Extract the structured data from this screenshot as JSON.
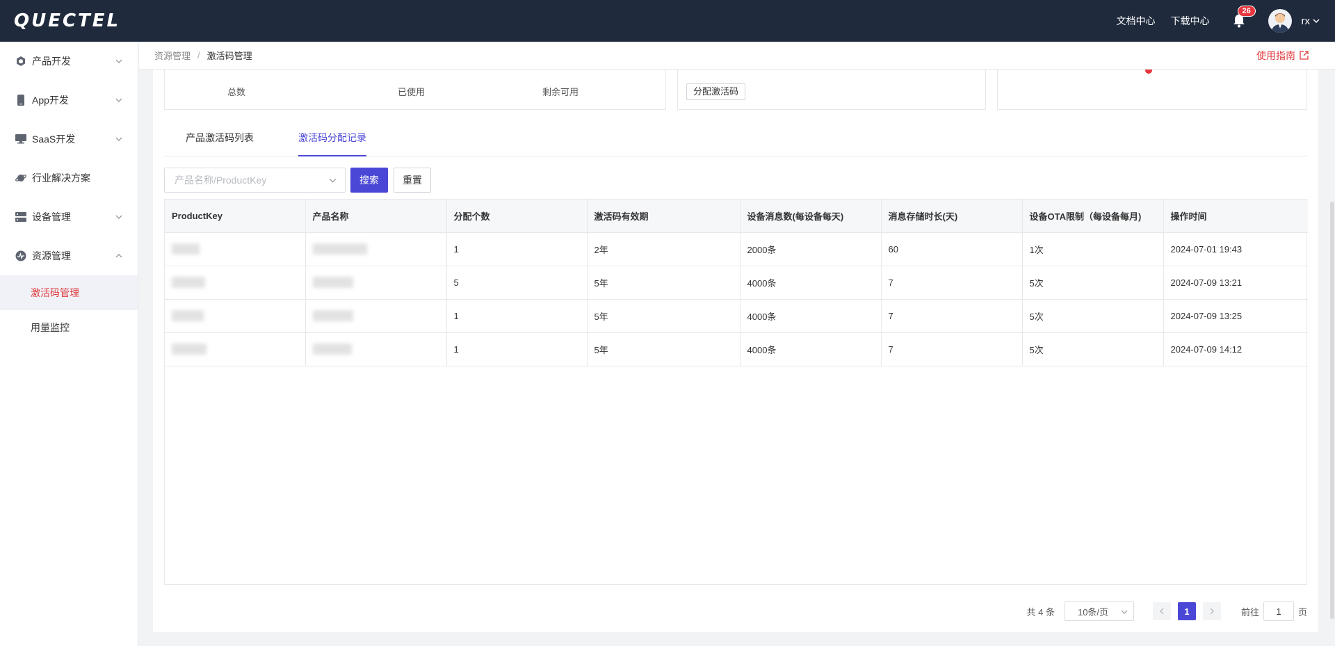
{
  "header": {
    "logo_text": "QUECTEL",
    "links": [
      "文档中心",
      "下载中心"
    ],
    "notification_count": "26",
    "user_name": "rx"
  },
  "sidebar": {
    "items": [
      {
        "label": "产品开发",
        "icon": "cube-icon",
        "expandable": true
      },
      {
        "label": "App开发",
        "icon": "phone-icon",
        "expandable": true
      },
      {
        "label": "SaaS开发",
        "icon": "monitor-icon",
        "expandable": true
      },
      {
        "label": "行业解决方案",
        "icon": "planet-icon",
        "expandable": false
      },
      {
        "label": "设备管理",
        "icon": "server-icon",
        "expandable": true
      },
      {
        "label": "资源管理",
        "icon": "resource-icon",
        "expandable": true,
        "expanded": true
      }
    ],
    "subitems": [
      {
        "label": "激活码管理",
        "active": true
      },
      {
        "label": "用量监控",
        "active": false
      }
    ]
  },
  "breadcrumb": {
    "items": [
      "资源管理",
      "激活码管理"
    ],
    "separator": "/",
    "guide_label": "使用指南"
  },
  "stats": {
    "total_label": "总数",
    "used_label": "已使用",
    "remaining_label": "剩余可用",
    "assign_button": "分配激活码"
  },
  "tabs": [
    "产品激活码列表",
    "激活码分配记录"
  ],
  "filter": {
    "placeholder": "产品名称/ProductKey",
    "search_button": "搜索",
    "reset_button": "重置"
  },
  "table": {
    "columns": [
      "ProductKey",
      "产品名称",
      "分配个数",
      "激活码有效期",
      "设备消息数(每设备每天)",
      "消息存储时长(天)",
      "设备OTA限制（每设备每月)",
      "操作时间"
    ],
    "rows": [
      {
        "count": "1",
        "validity": "2年",
        "messages": "2000条",
        "storage": "60",
        "ota": "1次",
        "time": "2024-07-01 19:43"
      },
      {
        "count": "5",
        "validity": "5年",
        "messages": "4000条",
        "storage": "7",
        "ota": "5次",
        "time": "2024-07-09 13:21"
      },
      {
        "count": "1",
        "validity": "5年",
        "messages": "4000条",
        "storage": "7",
        "ota": "5次",
        "time": "2024-07-09 13:25"
      },
      {
        "count": "1",
        "validity": "5年",
        "messages": "4000条",
        "storage": "7",
        "ota": "5次",
        "time": "2024-07-09 14:12"
      }
    ]
  },
  "pagination": {
    "total": "共 4 条",
    "page_size": "10条/页",
    "current_page": "1",
    "goto_label": "前往",
    "goto_value": "1",
    "goto_unit": "页"
  },
  "colors": {
    "header_bg": "#1f2a3d",
    "primary": "#4b47d6",
    "accent_red": "#e03a3e"
  }
}
